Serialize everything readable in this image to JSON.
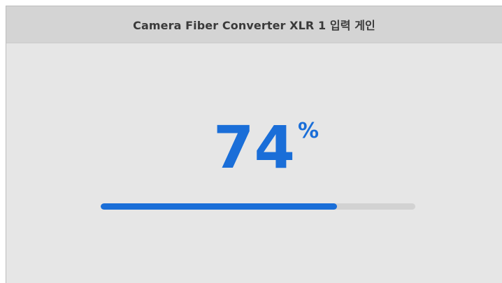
{
  "header": {
    "title": "Camera Fiber Converter XLR 1 입력 게인"
  },
  "gain": {
    "value": "74",
    "unit": "%",
    "level": 0.75
  },
  "colors": {
    "accent": "#1a6ed8",
    "track": "#d2d2d2",
    "panel": "#e6e6e6",
    "header": "#d4d4d4"
  }
}
